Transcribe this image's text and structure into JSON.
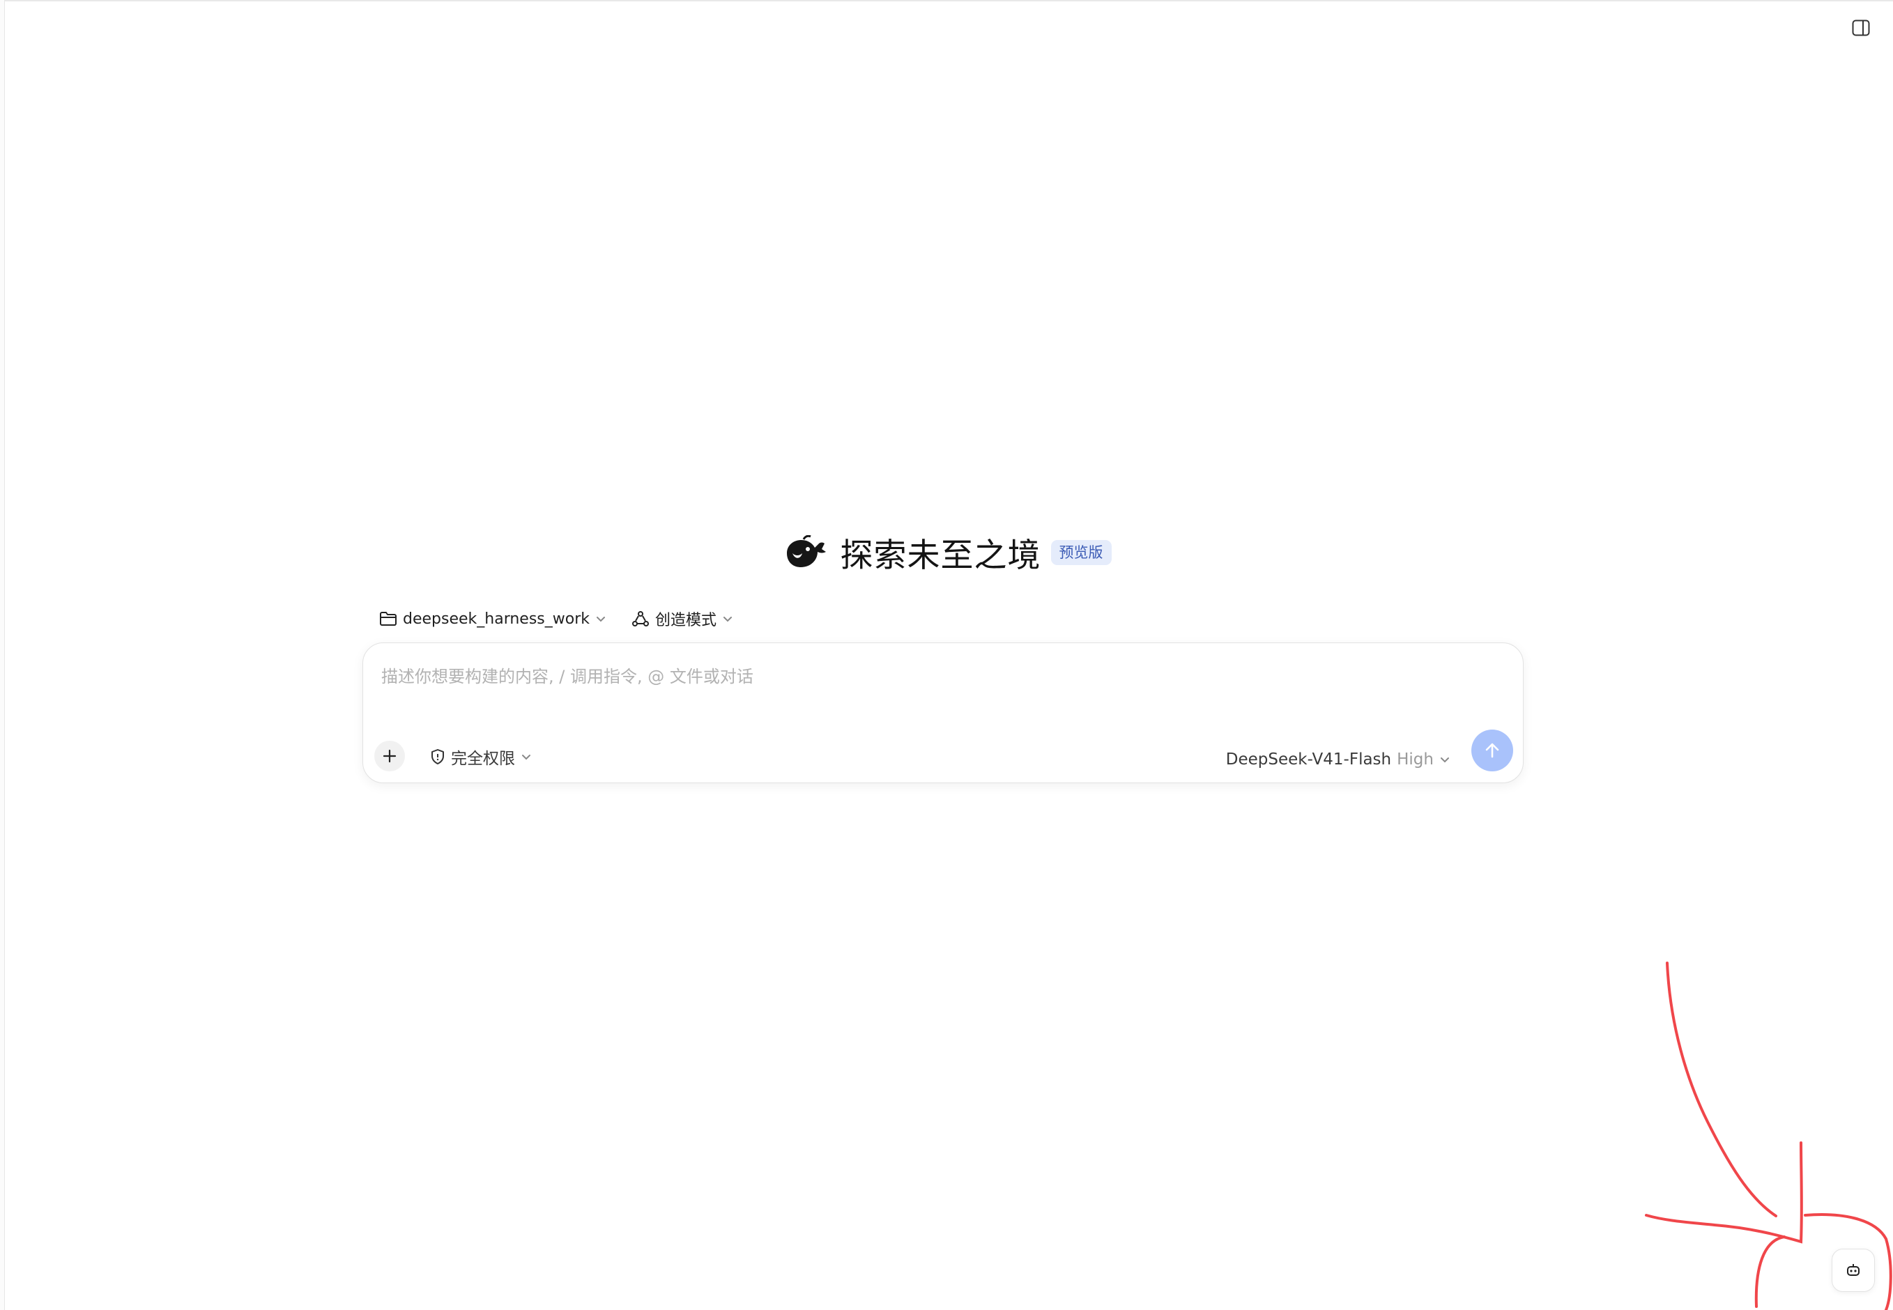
{
  "hero": {
    "title": "探索未至之境",
    "badge": "预览版"
  },
  "selectors": {
    "workspace_label": "deepseek_harness_work",
    "mode_label": "创造模式"
  },
  "composer": {
    "placeholder": "描述你想要构建的内容, / 调用指令, @ 文件或对话",
    "permission_label": "完全权限",
    "model_name": "DeepSeek-V41-Flash",
    "model_level": "High"
  },
  "icons": {
    "sidebar_toggle": "sidebar-toggle-icon",
    "logo": "whale-logo-icon",
    "folder": "folder-icon",
    "mode": "recycle-icon",
    "plus": "plus-icon",
    "shield": "shield-icon",
    "send": "arrow-up-icon",
    "assistant": "robot-icon"
  },
  "colors": {
    "send_button": "#a9c2fb",
    "badge_bg": "#e5ecfb",
    "badge_text": "#3b5bb5",
    "annotation": "#f0464a"
  }
}
